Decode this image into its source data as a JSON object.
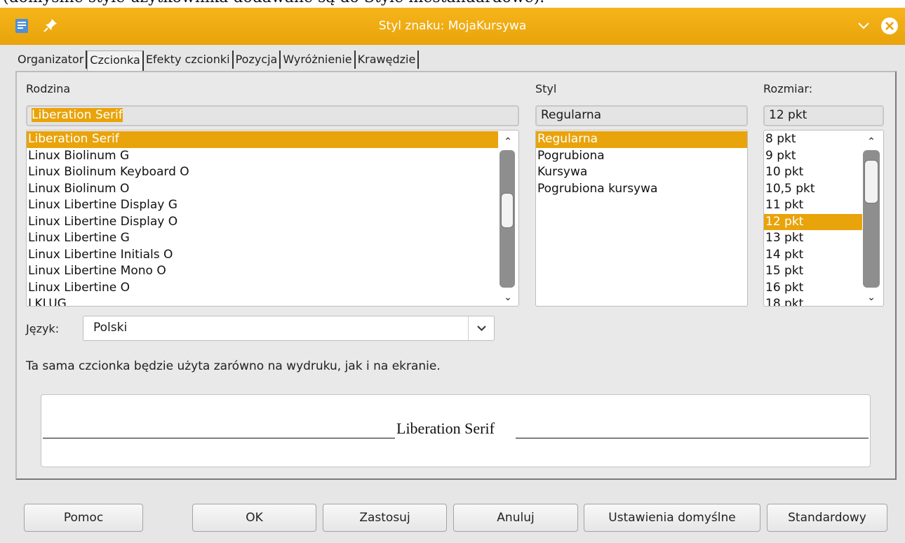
{
  "background_text": "(domyślne style użytkownika dodawane są do Style niestandardowe).",
  "window": {
    "title": "Styl znaku: MojaKursywa",
    "accent_color": "#e9a30b"
  },
  "tabs": [
    "Organizator",
    "Czcionka",
    "Efekty czcionki",
    "Pozycja",
    "Wyróżnienie",
    "Krawędzie"
  ],
  "active_tab": "Czcionka",
  "family": {
    "label": "Rodzina",
    "value": "Liberation Serif",
    "items": [
      "Liberation Serif",
      "Linux Biolinum G",
      "Linux Biolinum Keyboard O",
      "Linux Biolinum O",
      "Linux Libertine Display G",
      "Linux Libertine Display O",
      "Linux Libertine G",
      "Linux Libertine Initials O",
      "Linux Libertine Mono O",
      "Linux Libertine O",
      "LKLUG"
    ]
  },
  "style": {
    "label": "Styl",
    "value": "Regularna",
    "items": [
      "Regularna",
      "Pogrubiona",
      "Kursywa",
      "Pogrubiona kursywa"
    ]
  },
  "size": {
    "label": "Rozmiar:",
    "value": "12 pkt",
    "items": [
      "8 pkt",
      "9 pkt",
      "10 pkt",
      "10,5 pkt",
      "11 pkt",
      "12 pkt",
      "13 pkt",
      "14 pkt",
      "15 pkt",
      "16 pkt",
      "18 pkt"
    ]
  },
  "language": {
    "label": "Język:",
    "value": "Polski"
  },
  "info_text": "Ta sama czcionka będzie użyta zarówno na wydruku, jak i na ekranie.",
  "preview_text": "Liberation Serif",
  "buttons": {
    "help": "Pomoc",
    "ok": "OK",
    "apply": "Zastosuj",
    "cancel": "Anuluj",
    "defaults": "Ustawienia domyślne",
    "standard": "Standardowy"
  }
}
